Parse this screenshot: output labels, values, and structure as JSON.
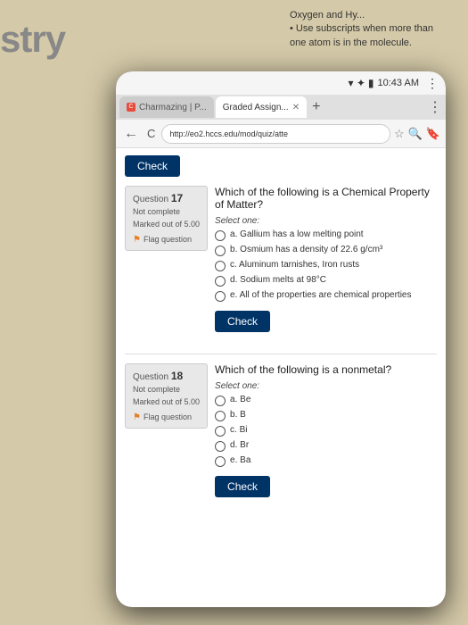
{
  "background": {
    "bg_text_line1": "Oxygen and Hy...",
    "bg_bullet": "• Use subscripts when more than one atom is in the molecule.",
    "bg_word": "stry"
  },
  "status_bar": {
    "time": "10:43 AM",
    "wifi": "▾",
    "signal": "✦",
    "battery": "▮"
  },
  "tabs": [
    {
      "label": "Charmazing | P...",
      "favicon": "C",
      "active": false
    },
    {
      "label": "Graded Assign...",
      "favicon": "",
      "active": true
    }
  ],
  "address_bar": {
    "url": "http://eo2.hccs.edu/mod/quiz/atte",
    "back": "←",
    "refresh": "C"
  },
  "page": {
    "check_button": "Check",
    "questions": [
      {
        "number": "17",
        "label": "Question",
        "status": "Not complete",
        "marks": "Marked out of 5.00",
        "flag_label": "Flag question",
        "text": "Which of the following is a Chemical Property of Matter?",
        "select_one": "Select one:",
        "options": [
          "a. Gallium has a low melting point",
          "b. Osmium has a density of 22.6 g/cm³",
          "c. Aluminum tarnishes, Iron rusts",
          "d. Sodium melts at 98°C",
          "e. All of the properties are chemical properties"
        ],
        "check_button": "Check"
      },
      {
        "number": "18",
        "label": "Question",
        "status": "Not complete",
        "marks": "Marked out of 5.00",
        "flag_label": "Flag question",
        "text": "Which of the following is a nonmetal?",
        "select_one": "Select one:",
        "options": [
          "a. Be",
          "b. B",
          "c. Bi",
          "d. Br",
          "e. Ba"
        ],
        "check_button": "Check"
      }
    ]
  }
}
